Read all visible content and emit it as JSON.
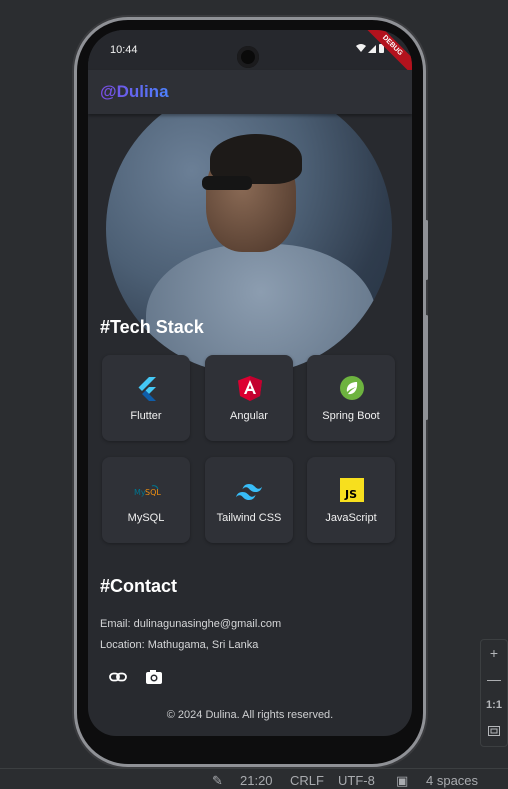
{
  "ide": {
    "status_time": "21:20",
    "line_ending": "CRLF",
    "encoding": "UTF-8",
    "indent": "4 spaces"
  },
  "zoom": {
    "plus": "+",
    "minus": "—",
    "reset": "1:1"
  },
  "device": {
    "time": "10:44",
    "debug_banner": "DEBUG"
  },
  "app": {
    "brand": "@Dulina",
    "tech_stack_title": "#Tech Stack",
    "tech": [
      {
        "label": "Flutter",
        "icon": "flutter-icon"
      },
      {
        "label": "Angular",
        "icon": "angular-icon"
      },
      {
        "label": "Spring Boot",
        "icon": "spring-boot-icon"
      },
      {
        "label": "MySQL",
        "icon": "mysql-icon"
      },
      {
        "label": "Tailwind CSS",
        "icon": "tailwind-icon"
      },
      {
        "label": "JavaScript",
        "icon": "javascript-icon"
      }
    ],
    "contact_title": "#Contact",
    "email": "Email: dulinagunasinghe@gmail.com",
    "location": "Location: Mathugama, Sri Lanka",
    "social": [
      "link-icon",
      "camera-icon"
    ],
    "footer": "© 2024 Dulina. All rights reserved."
  },
  "colors": {
    "background": "#282a2f",
    "card": "#2f3137",
    "brand_gradient_start": "#7a4be0",
    "brand_gradient_end": "#4c82ff",
    "debug": "#b3121d"
  }
}
